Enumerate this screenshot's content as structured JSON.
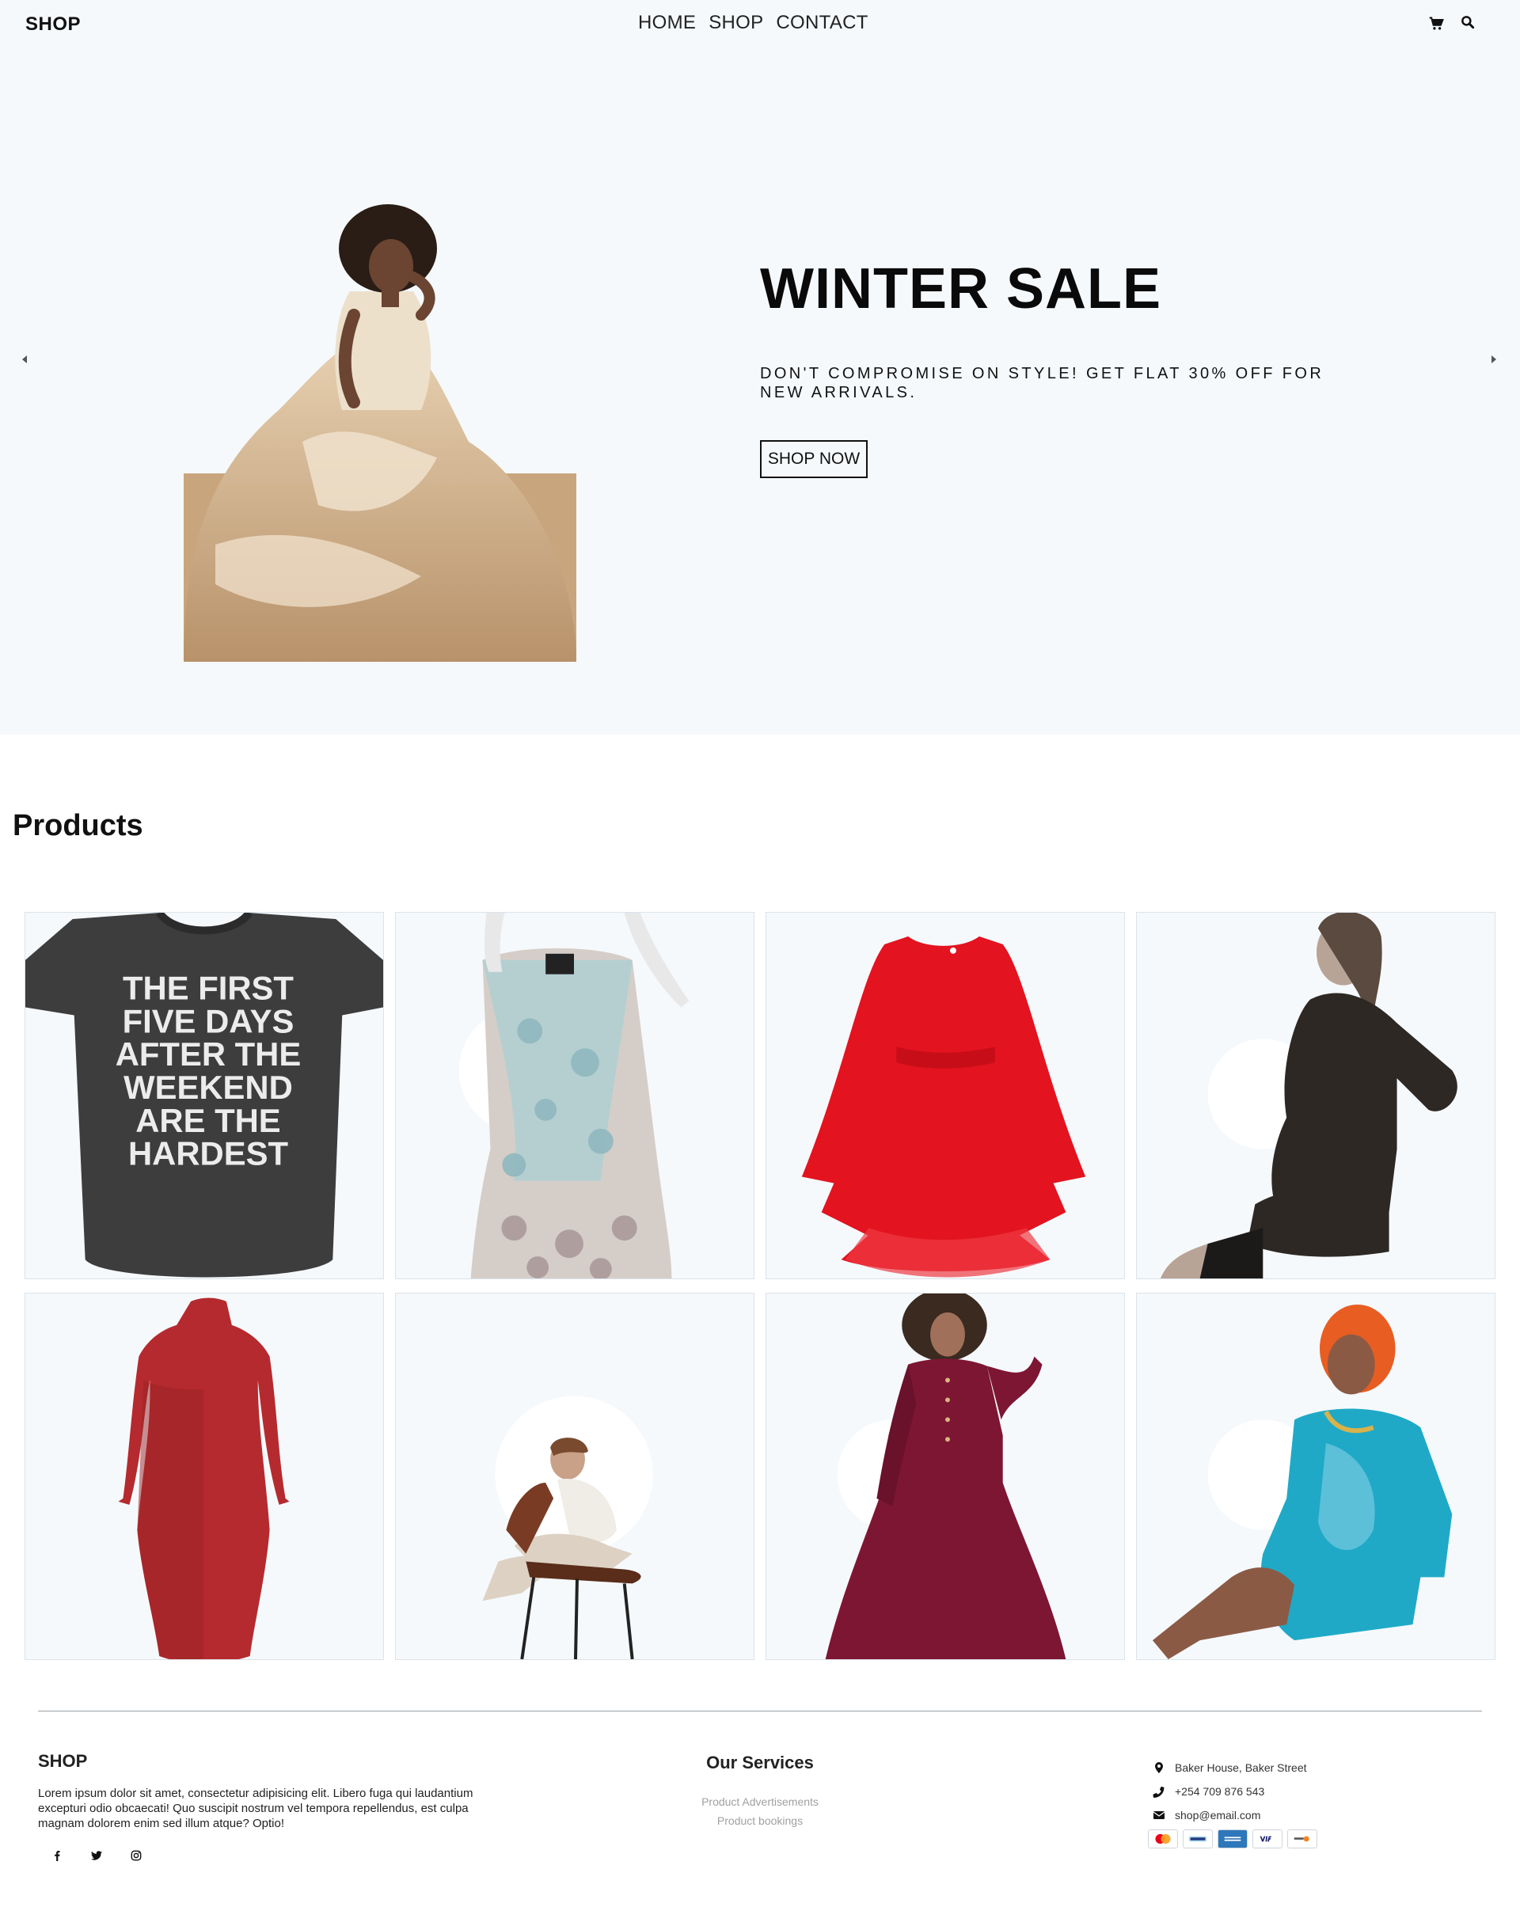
{
  "brand": {
    "logo": "SHOP"
  },
  "nav": {
    "links": [
      "HOME",
      "SHOP",
      "CONTACT"
    ],
    "icons": [
      "cart-icon",
      "search-icon"
    ]
  },
  "hero": {
    "title": "WINTER SALE",
    "description": "DON'T COMPROMISE ON STYLE! GET FLAT 30% OFF FOR NEW ARRIVALS.",
    "button": "SHOP NOW",
    "prev_icon": "caret-left-icon",
    "next_icon": "caret-right-icon"
  },
  "products": {
    "title": "Products",
    "items": [
      {
        "image": "graphic-tshirt",
        "text": [
          "THE FIRST",
          "FIVE DAYS",
          "AFTER THE",
          "WEEKEND",
          "ARE THE",
          "HARDEST"
        ]
      },
      {
        "image": "floral-maxi-dress-on-mannequin"
      },
      {
        "image": "red-lace-bell-sleeve-dress"
      },
      {
        "image": "woman-in-black-wrap-dress"
      },
      {
        "image": "red-long-sleeve-bodycon-dress"
      },
      {
        "image": "woman-on-chair"
      },
      {
        "image": "burgundy-corduroy-dress"
      },
      {
        "image": "woman-in-turquoise-dress"
      }
    ]
  },
  "footer": {
    "logo": "SHOP",
    "description": "Lorem ipsum dolor sit amet, consectetur adipisicing elit. Libero fuga qui laudantium excepturi odio obcaecati! Quo suscipit nostrum vel tempora repellendus, est culpa magnam dolorem enim sed illum atque? Optio!",
    "social_icons": [
      "facebook-icon",
      "twitter-icon",
      "instagram-icon"
    ],
    "services_title": "Our Services",
    "services": [
      "Product Advertisements",
      "Product bookings"
    ],
    "contact": {
      "address": "Baker House, Baker Street",
      "phone": "+254 709 876 543",
      "email": "shop@email.com"
    },
    "payments": [
      "mastercard-icon",
      "paypal-icon",
      "amex-icon",
      "visa-icon",
      "discover-icon"
    ]
  },
  "colors": {
    "hero_bg": "#f5f9fc",
    "card_bg": "#f5f9fc",
    "text": "#111111"
  }
}
